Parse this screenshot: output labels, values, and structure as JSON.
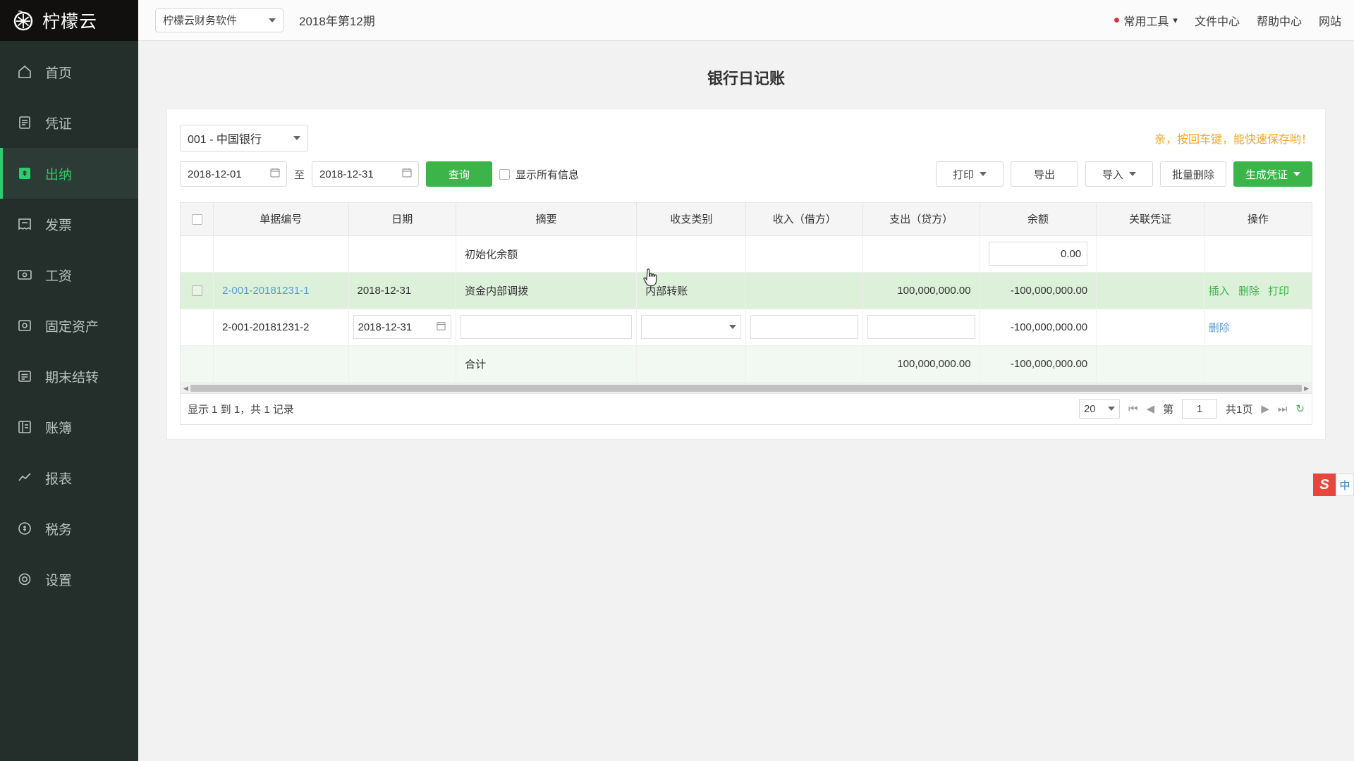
{
  "sidebar": {
    "logo_text": "柠檬云",
    "items": [
      {
        "label": "首页",
        "icon": "home-icon"
      },
      {
        "label": "凭证",
        "icon": "document-icon"
      },
      {
        "label": "出纳",
        "icon": "cashier-icon",
        "active": true
      },
      {
        "label": "发票",
        "icon": "invoice-icon"
      },
      {
        "label": "工资",
        "icon": "salary-icon"
      },
      {
        "label": "固定资产",
        "icon": "asset-icon"
      },
      {
        "label": "期末结转",
        "icon": "carryover-icon"
      },
      {
        "label": "账簿",
        "icon": "ledger-icon"
      },
      {
        "label": "报表",
        "icon": "report-icon"
      },
      {
        "label": "税务",
        "icon": "tax-icon"
      },
      {
        "label": "设置",
        "icon": "gear-icon"
      }
    ]
  },
  "topbar": {
    "company": "柠檬云财务软件",
    "period": "2018年第12期",
    "right_items": [
      {
        "label": "常用工具",
        "dot": true,
        "caret": true
      },
      {
        "label": "文件中心"
      },
      {
        "label": "帮助中心"
      },
      {
        "label": "网站"
      }
    ]
  },
  "page": {
    "title": "银行日记账"
  },
  "filters": {
    "bank_account": "001 - 中国银行",
    "date_from": "2018-12-01",
    "date_to": "2018-12-31",
    "date_separator": "至",
    "query_label": "查询",
    "show_all_label": "显示所有信息",
    "show_all_checked": false,
    "hint": "亲，按回车键，能快速保存哟！",
    "buttons": [
      {
        "label": "打印",
        "caret": true
      },
      {
        "label": "导出",
        "caret": false
      },
      {
        "label": "导入",
        "caret": true
      },
      {
        "label": "批量删除",
        "caret": false
      },
      {
        "label": "生成凭证",
        "caret": true,
        "primary": true
      }
    ]
  },
  "table": {
    "columns": [
      "",
      "单据编号",
      "日期",
      "摘要",
      "收支类别",
      "收入（借方）",
      "支出（贷方）",
      "余额",
      "关联凭证",
      "操作"
    ],
    "rows": [
      {
        "type": "opening",
        "checkbox": false,
        "doc_no": "",
        "date": "",
        "abstract": "初始化余额",
        "category": "",
        "income": "",
        "expense": "",
        "balance": "0.00",
        "voucher": "",
        "ops": []
      },
      {
        "type": "data",
        "checkbox": true,
        "doc_no": "2-001-20181231-1",
        "date": "2018-12-31",
        "abstract": "资金内部调拨",
        "category": "内部转账",
        "income": "",
        "expense": "100,000,000.00",
        "balance": "-100,000,000.00",
        "voucher": "",
        "ops": [
          "插入",
          "删除",
          "打印"
        ]
      },
      {
        "type": "editing",
        "checkbox": false,
        "doc_no": "2-001-20181231-2",
        "date": "2018-12-31",
        "abstract": "",
        "category": "",
        "income": "",
        "expense": "",
        "balance": "-100,000,000.00",
        "voucher": "",
        "ops": [
          "删除"
        ]
      },
      {
        "type": "total",
        "checkbox": false,
        "doc_no": "",
        "date": "",
        "abstract": "合计",
        "category": "",
        "income": "",
        "expense": "100,000,000.00",
        "balance": "-100,000,000.00",
        "voucher": "",
        "ops": []
      }
    ]
  },
  "footer": {
    "summary": "显示 1 到 1，共 1 记录",
    "page_size": "20",
    "page_prefix": "第",
    "page_number": "1",
    "page_total": "共1页"
  },
  "ime": {
    "logo": "S",
    "mode": "中"
  },
  "colors": {
    "sidebar_bg": "#242f2b",
    "accent_green": "#3bb54a",
    "active_green": "#35c46a",
    "hint_orange": "#f5a623",
    "link_blue": "#5b9bd5",
    "row_green": "#ddf0da"
  }
}
